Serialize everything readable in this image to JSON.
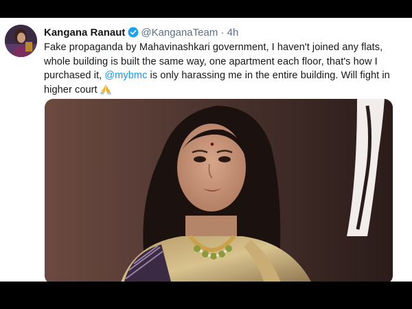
{
  "tweet": {
    "display_name": "Kangana Ranaut",
    "handle": "@KanganaTeam",
    "separator": "·",
    "time": "4h",
    "verified_icon": "verified-badge-icon",
    "text_before_mention": "Fake propaganda by Mahavinashkari government, I haven't joined any flats, whole building is built the same way, one apartment each floor, that's how I purchased it, ",
    "mention": "@mybmc",
    "text_after_mention": " is only harassing me in the entire building. Will fight in higher court",
    "emoji_icon": "folded-hands-icon"
  },
  "colors": {
    "link": "#1b95e0",
    "verified": "#1da1f2",
    "text": "#14171a",
    "secondary": "#5b7083"
  }
}
